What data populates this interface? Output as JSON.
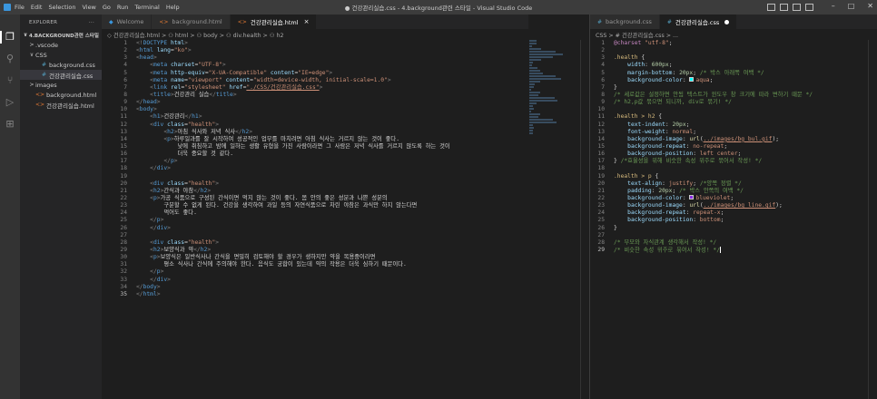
{
  "window": {
    "menu": [
      "File",
      "Edit",
      "Selection",
      "View",
      "Go",
      "Run",
      "Terminal",
      "Help"
    ],
    "title": "● 건강관리실습.css - 4.background관련 스타일 - Visual Studio Code"
  },
  "explorer": {
    "header": "EXPLORER",
    "rows": [
      {
        "t": "4.BACKGROUND관련 스타일",
        "kind": "root",
        "indent": 0,
        "chev": "∨"
      },
      {
        "t": ".vscode",
        "kind": "folder",
        "indent": 1,
        "chev": ">"
      },
      {
        "t": "CSS",
        "kind": "folder",
        "indent": 1,
        "chev": "∨"
      },
      {
        "t": "background.css",
        "kind": "css",
        "indent": 2,
        "chev": ""
      },
      {
        "t": "건강관리실습.css",
        "kind": "css",
        "indent": 2,
        "chev": "",
        "sel": true
      },
      {
        "t": "images",
        "kind": "folder",
        "indent": 1,
        "chev": ">"
      },
      {
        "t": "background.html",
        "kind": "html",
        "indent": 1,
        "chev": ""
      },
      {
        "t": "건강관리실습.html",
        "kind": "html",
        "indent": 1,
        "chev": ""
      }
    ]
  },
  "left_tabs": [
    {
      "label": "Welcome",
      "icon": "vscode-icon",
      "active": false
    },
    {
      "label": "background.html",
      "icon": "html-icon",
      "active": false
    },
    {
      "label": "건강관리실습.html",
      "icon": "html-icon",
      "active": true,
      "close": "×"
    }
  ],
  "right_tabs": [
    {
      "label": "background.css",
      "icon": "css-icon",
      "active": false
    },
    {
      "label": "건강관리실습.css",
      "icon": "css-icon",
      "active": true,
      "dirty": true
    }
  ],
  "left_breadcrumb": "◇ 건강관리실습.html > ⚇ html > ⚇ body > ⚇ div.health > ⚇ h2",
  "right_breadcrumb": "CSS > # 건강관리실습.css > ...",
  "colors": {
    "tag": "#569cd6",
    "attr": "#9cdcfe",
    "str": "#ce9178",
    "text": "#d4d4d4",
    "punct": "#808080",
    "selector": "#d7ba7d",
    "prop": "#9cdcfe",
    "value": "#ce9178",
    "num": "#b5cea8",
    "comment": "#6a9955",
    "at": "#c586c0",
    "fn": "#dcdcaa"
  },
  "html_lines": [
    [
      [
        "p",
        "<!"
      ],
      [
        "tag",
        "DOCTYPE"
      ],
      [
        "t",
        " "
      ],
      [
        "attr",
        "html"
      ],
      [
        "p",
        ">"
      ]
    ],
    [
      [
        "p",
        "<"
      ],
      [
        "tag",
        "html"
      ],
      [
        "t",
        " "
      ],
      [
        "attr",
        "lang"
      ],
      [
        "t",
        "="
      ],
      [
        "str",
        "\"ko\""
      ],
      [
        "p",
        ">"
      ]
    ],
    [
      [
        "p",
        "<"
      ],
      [
        "tag",
        "head"
      ],
      [
        "p",
        ">"
      ]
    ],
    [
      [
        "t",
        "    "
      ],
      [
        "p",
        "<"
      ],
      [
        "tag",
        "meta"
      ],
      [
        "t",
        " "
      ],
      [
        "attr",
        "charset"
      ],
      [
        "t",
        "="
      ],
      [
        "str",
        "\"UTF-8\""
      ],
      [
        "p",
        ">"
      ]
    ],
    [
      [
        "t",
        "    "
      ],
      [
        "p",
        "<"
      ],
      [
        "tag",
        "meta"
      ],
      [
        "t",
        " "
      ],
      [
        "attr",
        "http-equiv"
      ],
      [
        "t",
        "="
      ],
      [
        "str",
        "\"X-UA-Compatible\""
      ],
      [
        "t",
        " "
      ],
      [
        "attr",
        "content"
      ],
      [
        "t",
        "="
      ],
      [
        "str",
        "\"IE=edge\""
      ],
      [
        "p",
        ">"
      ]
    ],
    [
      [
        "t",
        "    "
      ],
      [
        "p",
        "<"
      ],
      [
        "tag",
        "meta"
      ],
      [
        "t",
        " "
      ],
      [
        "attr",
        "name"
      ],
      [
        "t",
        "="
      ],
      [
        "str",
        "\"viewport\""
      ],
      [
        "t",
        " "
      ],
      [
        "attr",
        "content"
      ],
      [
        "t",
        "="
      ],
      [
        "str",
        "\"width=device-width, initial-scale=1.0\""
      ],
      [
        "p",
        ">"
      ]
    ],
    [
      [
        "t",
        "    "
      ],
      [
        "p",
        "<"
      ],
      [
        "tag",
        "link"
      ],
      [
        "t",
        " "
      ],
      [
        "attr",
        "rel"
      ],
      [
        "t",
        "="
      ],
      [
        "str",
        "\"stylesheet\""
      ],
      [
        "t",
        " "
      ],
      [
        "attr",
        "href"
      ],
      [
        "t",
        "="
      ],
      [
        "str",
        "\"./CSS/건강관리실습.css\""
      ],
      [
        "p",
        ">"
      ]
    ],
    [
      [
        "t",
        "    "
      ],
      [
        "p",
        "<"
      ],
      [
        "tag",
        "title"
      ],
      [
        "p",
        ">"
      ],
      [
        "t",
        "건강관리 실습"
      ],
      [
        "p",
        "</"
      ],
      [
        "tag",
        "title"
      ],
      [
        "p",
        ">"
      ]
    ],
    [
      [
        "p",
        "</"
      ],
      [
        "tag",
        "head"
      ],
      [
        "p",
        ">"
      ]
    ],
    [
      [
        "p",
        "<"
      ],
      [
        "tag",
        "body"
      ],
      [
        "p",
        ">"
      ]
    ],
    [
      [
        "t",
        "    "
      ],
      [
        "p",
        "<"
      ],
      [
        "tag",
        "h1"
      ],
      [
        "p",
        ">"
      ],
      [
        "t",
        "건강관리"
      ],
      [
        "p",
        "</"
      ],
      [
        "tag",
        "h1"
      ],
      [
        "p",
        ">"
      ]
    ],
    [
      [
        "t",
        "    "
      ],
      [
        "p",
        "<"
      ],
      [
        "tag",
        "div"
      ],
      [
        "t",
        " "
      ],
      [
        "attr",
        "class"
      ],
      [
        "t",
        "="
      ],
      [
        "str",
        "\"health\""
      ],
      [
        "p",
        ">"
      ]
    ],
    [
      [
        "t",
        "        "
      ],
      [
        "p",
        "<"
      ],
      [
        "tag",
        "h2"
      ],
      [
        "p",
        ">"
      ],
      [
        "t",
        "아침 식사와 저녁 식사"
      ],
      [
        "p",
        "</"
      ],
      [
        "tag",
        "h2"
      ],
      [
        "p",
        ">"
      ]
    ],
    [
      [
        "t",
        "        "
      ],
      [
        "p",
        "<"
      ],
      [
        "tag",
        "p"
      ],
      [
        "p",
        ">"
      ],
      [
        "t",
        "하루일과를 잘 시작하여 성공적인 업무를 마치려면 아침 식사는 거르지 않는 것이 좋다."
      ]
    ],
    [
      [
        "t",
        "            낮에 취침하고 밤에 일하는 생활 유형을 가진 사람이라면 그 사람은 저녁 식사를 거르지 않도록 하는 것이"
      ]
    ],
    [
      [
        "t",
        "            더욱 중요할 것 같다."
      ]
    ],
    [
      [
        "t",
        "        "
      ],
      [
        "p",
        "</"
      ],
      [
        "tag",
        "p"
      ],
      [
        "p",
        ">"
      ]
    ],
    [
      [
        "t",
        "    "
      ],
      [
        "p",
        "</"
      ],
      [
        "tag",
        "div"
      ],
      [
        "p",
        ">"
      ]
    ],
    [
      [
        "t",
        ""
      ]
    ],
    [
      [
        "t",
        "    "
      ],
      [
        "p",
        "<"
      ],
      [
        "tag",
        "div"
      ],
      [
        "t",
        " "
      ],
      [
        "attr",
        "class"
      ],
      [
        "t",
        "="
      ],
      [
        "str",
        "\"health\""
      ],
      [
        "p",
        ">"
      ]
    ],
    [
      [
        "t",
        "    "
      ],
      [
        "p",
        "<"
      ],
      [
        "tag",
        "h2"
      ],
      [
        "p",
        ">"
      ],
      [
        "t",
        "간식과 야참"
      ],
      [
        "p",
        "</"
      ],
      [
        "tag",
        "h2"
      ],
      [
        "p",
        ">"
      ]
    ],
    [
      [
        "t",
        "    "
      ],
      [
        "p",
        "<"
      ],
      [
        "tag",
        "p"
      ],
      [
        "p",
        ">"
      ],
      [
        "t",
        "가공 식품으로 구성된 간식이면 먹지 않는 것이 좋다. 몸 안의 좋은 성분과 나쁜 성분의"
      ]
    ],
    [
      [
        "t",
        "        구분할 수 없게 된다. 건강을 생각하여 과일 등의 자연식품으로 차린 야참은 과식만 하지 않는다면"
      ]
    ],
    [
      [
        "t",
        "        먹어도 좋다."
      ]
    ],
    [
      [
        "t",
        "    "
      ],
      [
        "p",
        "</"
      ],
      [
        "tag",
        "p"
      ],
      [
        "p",
        ">"
      ]
    ],
    [
      [
        "t",
        "    "
      ],
      [
        "p",
        "</"
      ],
      [
        "tag",
        "div"
      ],
      [
        "p",
        ">"
      ]
    ],
    [
      [
        "t",
        ""
      ]
    ],
    [
      [
        "t",
        "    "
      ],
      [
        "p",
        "<"
      ],
      [
        "tag",
        "div"
      ],
      [
        "t",
        " "
      ],
      [
        "attr",
        "class"
      ],
      [
        "t",
        "="
      ],
      [
        "str",
        "\"health\""
      ],
      [
        "p",
        ">"
      ]
    ],
    [
      [
        "t",
        "    "
      ],
      [
        "p",
        "<"
      ],
      [
        "tag",
        "h2"
      ],
      [
        "p",
        ">"
      ],
      [
        "t",
        "보양식과 약"
      ],
      [
        "p",
        "</"
      ],
      [
        "tag",
        "h2"
      ],
      [
        "p",
        ">"
      ]
    ],
    [
      [
        "t",
        "    "
      ],
      [
        "p",
        "<"
      ],
      [
        "tag",
        "p"
      ],
      [
        "p",
        ">"
      ],
      [
        "t",
        "보양식은 일반식사나 간식을 면밀히 검토해야 할 경우가 생하지만 약을 복용중이라면"
      ]
    ],
    [
      [
        "t",
        "        평소 식사나 간식에 주의해야 한다. 음식도 궁합이 있는데 약의 작용은 더욱 심하기 때문이다."
      ]
    ],
    [
      [
        "t",
        "    "
      ],
      [
        "p",
        "</"
      ],
      [
        "tag",
        "p"
      ],
      [
        "p",
        ">"
      ]
    ],
    [
      [
        "t",
        "    "
      ],
      [
        "p",
        "</"
      ],
      [
        "tag",
        "div"
      ],
      [
        "p",
        ">"
      ]
    ],
    [
      [
        "p",
        "</"
      ],
      [
        "tag",
        "body"
      ],
      [
        "p",
        ">"
      ]
    ],
    [
      [
        "p",
        "</"
      ],
      [
        "tag",
        "html"
      ],
      [
        "p",
        ">"
      ]
    ]
  ],
  "css_lines": [
    [
      [
        "at",
        "@charset"
      ],
      [
        "t",
        " "
      ],
      [
        "str",
        "\"utf-8\""
      ],
      [
        "t",
        ";"
      ]
    ],
    [
      [
        "t",
        ""
      ]
    ],
    [
      [
        "selector",
        ".health"
      ],
      [
        "t",
        " {"
      ]
    ],
    [
      [
        "t",
        "    "
      ],
      [
        "prop",
        "width"
      ],
      [
        "t",
        ": "
      ],
      [
        "num",
        "600px"
      ],
      [
        "t",
        ";"
      ]
    ],
    [
      [
        "t",
        "    "
      ],
      [
        "prop",
        "margin-bottom"
      ],
      [
        "t",
        ": "
      ],
      [
        "num",
        "20px"
      ],
      [
        "t",
        "; "
      ],
      [
        "comment",
        "/* 박스 아래쪽 여백 */"
      ]
    ],
    [
      [
        "t",
        "    "
      ],
      [
        "prop",
        "background-color"
      ],
      [
        "t",
        ": "
      ],
      [
        "sw",
        "aqua"
      ],
      [
        "value",
        "aqua"
      ],
      [
        "t",
        ";"
      ]
    ],
    [
      [
        "t",
        "}"
      ]
    ],
    [
      [
        "comment",
        "/* 세로값은 설정하면 안됨 텍스트가 윈도우 창 크기에 따라 변하기 때문 */"
      ]
    ],
    [
      [
        "comment",
        "/* h2,p값 묶으면 되니까, div로 묶기! */"
      ]
    ],
    [
      [
        "t",
        ""
      ]
    ],
    [
      [
        "selector",
        ".health > h2"
      ],
      [
        "t",
        " {"
      ]
    ],
    [
      [
        "t",
        "    "
      ],
      [
        "prop",
        "text-indent"
      ],
      [
        "t",
        ": "
      ],
      [
        "num",
        "20px"
      ],
      [
        "t",
        ";"
      ]
    ],
    [
      [
        "t",
        "    "
      ],
      [
        "prop",
        "font-weight"
      ],
      [
        "t",
        ": "
      ],
      [
        "value",
        "normal"
      ],
      [
        "t",
        ";"
      ]
    ],
    [
      [
        "t",
        "    "
      ],
      [
        "prop",
        "background-image"
      ],
      [
        "t",
        ": "
      ],
      [
        "fn",
        "url"
      ],
      [
        "t",
        "("
      ],
      [
        "value",
        "../images/bg_bul.gif"
      ],
      [
        "t",
        ");"
      ]
    ],
    [
      [
        "t",
        "    "
      ],
      [
        "prop",
        "background-repeat"
      ],
      [
        "t",
        ": "
      ],
      [
        "value",
        "no-repeat"
      ],
      [
        "t",
        ";"
      ]
    ],
    [
      [
        "t",
        "    "
      ],
      [
        "prop",
        "background-position"
      ],
      [
        "t",
        ": "
      ],
      [
        "value",
        "left center"
      ],
      [
        "t",
        ";"
      ]
    ],
    [
      [
        "t",
        "} "
      ],
      [
        "comment",
        "/*효율성을 위해 비슷한 속성 위주로 묶어서 작성! */"
      ]
    ],
    [
      [
        "t",
        ""
      ]
    ],
    [
      [
        "selector",
        ".health > p"
      ],
      [
        "t",
        " {"
      ]
    ],
    [
      [
        "t",
        "    "
      ],
      [
        "prop",
        "text-align"
      ],
      [
        "t",
        ": "
      ],
      [
        "value",
        "justify"
      ],
      [
        "t",
        "; "
      ],
      [
        "comment",
        "/*양쪽 정렬 */"
      ]
    ],
    [
      [
        "t",
        "    "
      ],
      [
        "prop",
        "padding"
      ],
      [
        "t",
        ": "
      ],
      [
        "num",
        "20px"
      ],
      [
        "t",
        "; "
      ],
      [
        "comment",
        "/* 박스 안쪽의 여백 */"
      ]
    ],
    [
      [
        "t",
        "    "
      ],
      [
        "prop",
        "background-color"
      ],
      [
        "t",
        ": "
      ],
      [
        "sw",
        "blueviolet"
      ],
      [
        "value",
        "blueviolet"
      ],
      [
        "t",
        ";"
      ]
    ],
    [
      [
        "t",
        "    "
      ],
      [
        "prop",
        "background-image"
      ],
      [
        "t",
        ": "
      ],
      [
        "fn",
        "url"
      ],
      [
        "t",
        "("
      ],
      [
        "value",
        "../images/bg_line.gif"
      ],
      [
        "t",
        ");"
      ]
    ],
    [
      [
        "t",
        "    "
      ],
      [
        "prop",
        "background-repeat"
      ],
      [
        "t",
        ": "
      ],
      [
        "value",
        "repeat-x"
      ],
      [
        "t",
        ";"
      ]
    ],
    [
      [
        "t",
        "    "
      ],
      [
        "prop",
        "background-position"
      ],
      [
        "t",
        ": "
      ],
      [
        "value",
        "bottom"
      ],
      [
        "t",
        ";"
      ]
    ],
    [
      [
        "t",
        "}"
      ]
    ],
    [
      [
        "t",
        ""
      ]
    ],
    [
      [
        "comment",
        "/* 부모와 자식관계 생각해서 작성! */"
      ]
    ],
    [
      [
        "comment",
        "/* 비슷한 속성 위주로 묶어서 작성! */"
      ],
      [
        "cursor",
        ""
      ]
    ]
  ]
}
